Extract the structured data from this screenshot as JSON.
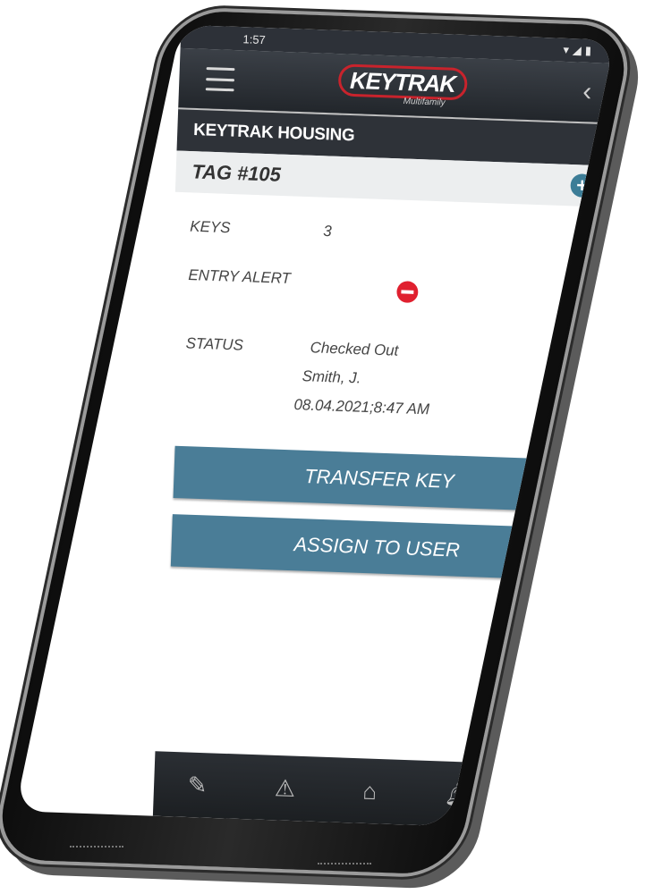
{
  "status_bar": {
    "time": "1:57"
  },
  "app": {
    "logo_text": "KEYTRAK",
    "logo_sub": "Multifamily"
  },
  "section": {
    "title": "KEYTRAK HOUSING"
  },
  "tag": {
    "label": "TAG #105"
  },
  "details": {
    "keys_label": "KEYS",
    "keys_value": "3",
    "entry_alert_label": "ENTRY ALERT",
    "status_label": "STATUS",
    "status_value": "Checked Out",
    "status_user": "Smith, J.",
    "status_time": "08.04.2021;8:47 AM"
  },
  "buttons": {
    "transfer": "TRANSFER KEY",
    "assign": "ASSIGN TO USER"
  },
  "colors": {
    "accent": "#4a7d97",
    "alert": "#e0202f",
    "header": "#2e3238"
  },
  "nav_icons": [
    "edit-icon",
    "warning-icon",
    "home-icon",
    "bell-icon",
    "search-icon"
  ]
}
